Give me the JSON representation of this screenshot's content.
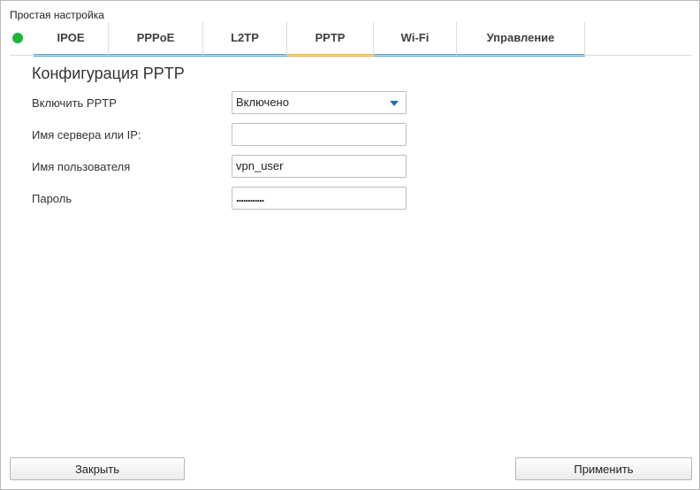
{
  "window": {
    "title": "Простая настройка"
  },
  "status": {
    "color": "#1db53a",
    "icon": "status-dot-icon"
  },
  "tabs": [
    {
      "label": "IPOE"
    },
    {
      "label": "PPPoE"
    },
    {
      "label": "L2TP"
    },
    {
      "label": "PPTP",
      "active": true
    },
    {
      "label": "Wi-Fi"
    },
    {
      "label": "Управление"
    }
  ],
  "colors": {
    "tab_underline": "#49a6d6",
    "active_tab_underline": "#f5a94e",
    "dropdown_caret": "#1e6fb5"
  },
  "form": {
    "title": "Конфигурация PPTP",
    "enable": {
      "label": "Включить PPTP",
      "value": "Включено",
      "options": [
        "Включено"
      ]
    },
    "server": {
      "label": "Имя сервера или IP:",
      "value": ""
    },
    "username": {
      "label": "Имя пользователя",
      "value": "vpn_user"
    },
    "password": {
      "label": "Пароль",
      "value": "............"
    }
  },
  "footer": {
    "close_label": "Закрыть",
    "apply_label": "Применить"
  }
}
